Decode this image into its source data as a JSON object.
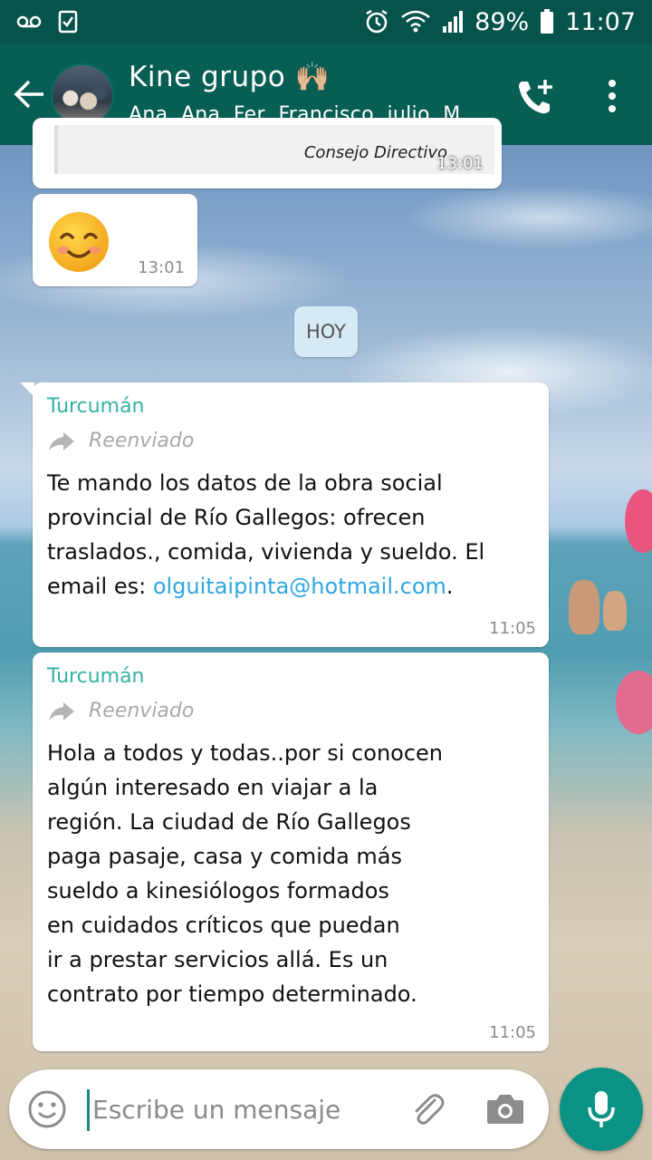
{
  "status_bar": {
    "battery": "89%",
    "time": "11:07",
    "icons": [
      "voicemail-icon",
      "checkbox-icon",
      "alarm-icon",
      "wifi-icon",
      "signal-icon",
      "battery-icon"
    ]
  },
  "header": {
    "title": "Kine grupo 🙌🏼",
    "subtitle": "Ana, Ana, Fer, Francisco, julio, M...",
    "icons": [
      "back-arrow-icon",
      "add-call-icon",
      "more-vert-icon"
    ]
  },
  "messages": {
    "previous_document": {
      "caption": "Consejo Directivo",
      "time": "13:01"
    },
    "emoji_message": {
      "emoji": "☺️",
      "time": "13:01"
    },
    "date_chip": "HOY",
    "msg1": {
      "sender": "Turcumán",
      "forwarded_label": "Reenviado",
      "text": "Te mando los datos de la obra social provincial de Río Gallegos: ofrecen traslados., comida, vivienda y sueldo. El email es: ",
      "link": "olguitaipinta@hotmail.com",
      "text_after": ".",
      "time": "11:05"
    },
    "msg2": {
      "sender": "Turcumán",
      "forwarded_label": "Reenviado",
      "text": "Hola a todos y todas..por si conocen\nalgún interesado en viajar a la\nregión.  La ciudad de Río Gallegos\npaga pasaje, casa y comida más\nsueldo a kinesiólogos formados\nen cuidados críticos que puedan\nir a prestar servicios allá.  Es un\ncontrato por tiempo determinado.",
      "time": "11:05"
    }
  },
  "composer": {
    "placeholder": "Escribe un mensaje",
    "icons": [
      "emoji-icon",
      "attach-icon",
      "camera-icon",
      "mic-icon"
    ]
  },
  "colors": {
    "status_bar": "#05534a",
    "app_bar": "#075e54",
    "sender": "#35b3a4",
    "link": "#30a6e0",
    "mic_button": "#0a9384"
  }
}
